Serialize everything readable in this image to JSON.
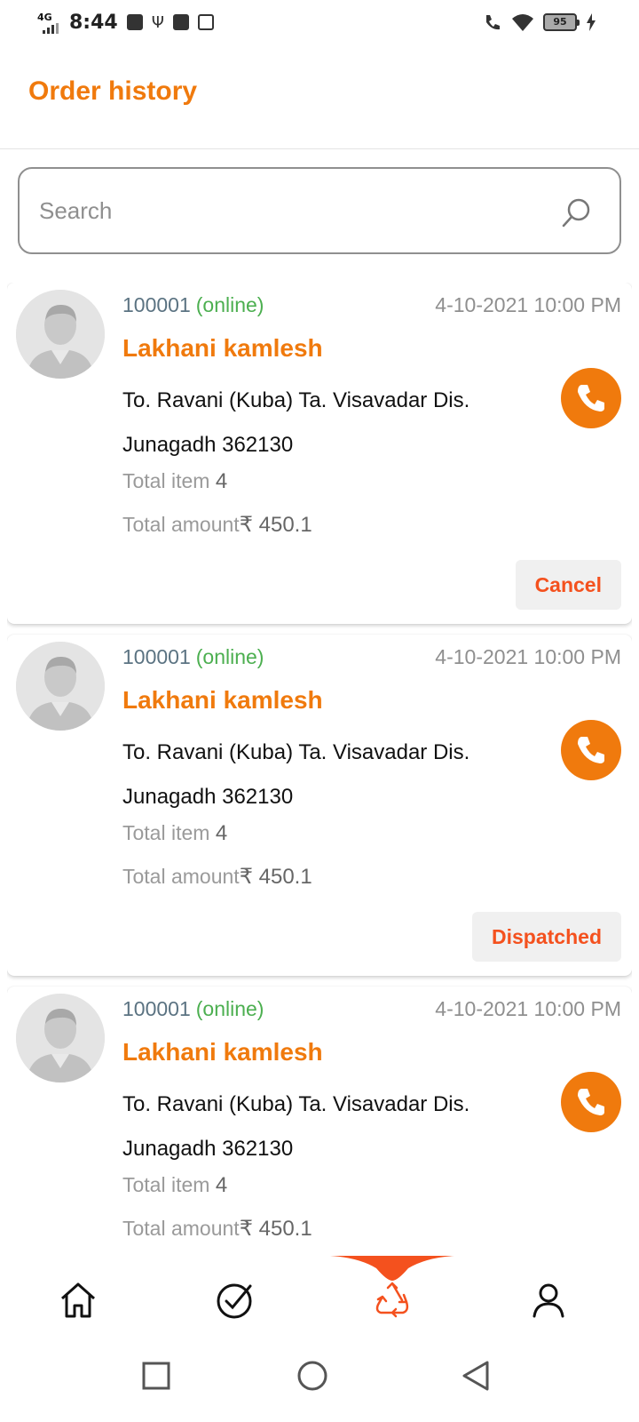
{
  "status_bar": {
    "network": "4G",
    "time": "8:44",
    "battery": "95"
  },
  "header": {
    "title": "Order history"
  },
  "search": {
    "placeholder": "Search"
  },
  "orders": [
    {
      "id": "100001",
      "type": "(online)",
      "date": "4-10-2021 10:00 PM",
      "name": "Lakhani kamlesh",
      "address": "To. Ravani (Kuba) Ta. Visavadar Dis. Junagadh 362130",
      "items_label": "Total item",
      "items_value": "4",
      "amount_label": "Total amount",
      "amount_value": "₹ 450.1",
      "action": "Cancel"
    },
    {
      "id": "100001",
      "type": "(online)",
      "date": "4-10-2021 10:00 PM",
      "name": "Lakhani kamlesh",
      "address": "To. Ravani (Kuba) Ta. Visavadar Dis. Junagadh 362130",
      "items_label": "Total item",
      "items_value": "4",
      "amount_label": "Total amount",
      "amount_value": "₹ 450.1",
      "action": "Dispatched"
    },
    {
      "id": "100001",
      "type": "(online)",
      "date": "4-10-2021 10:00 PM",
      "name": "Lakhani kamlesh",
      "address": "To. Ravani (Kuba) Ta. Visavadar Dis. Junagadh 362130",
      "items_label": "Total item",
      "items_value": "4",
      "amount_label": "Total amount",
      "amount_value": "₹ 450.1",
      "action": ""
    }
  ],
  "bottom_nav": {
    "items": [
      "home-icon",
      "check-circle-icon",
      "recycle-icon",
      "person-icon"
    ],
    "active": "recycle-icon"
  },
  "colors": {
    "accent": "#f07a0d",
    "status_action": "#f4511e",
    "online": "#4caf50"
  }
}
